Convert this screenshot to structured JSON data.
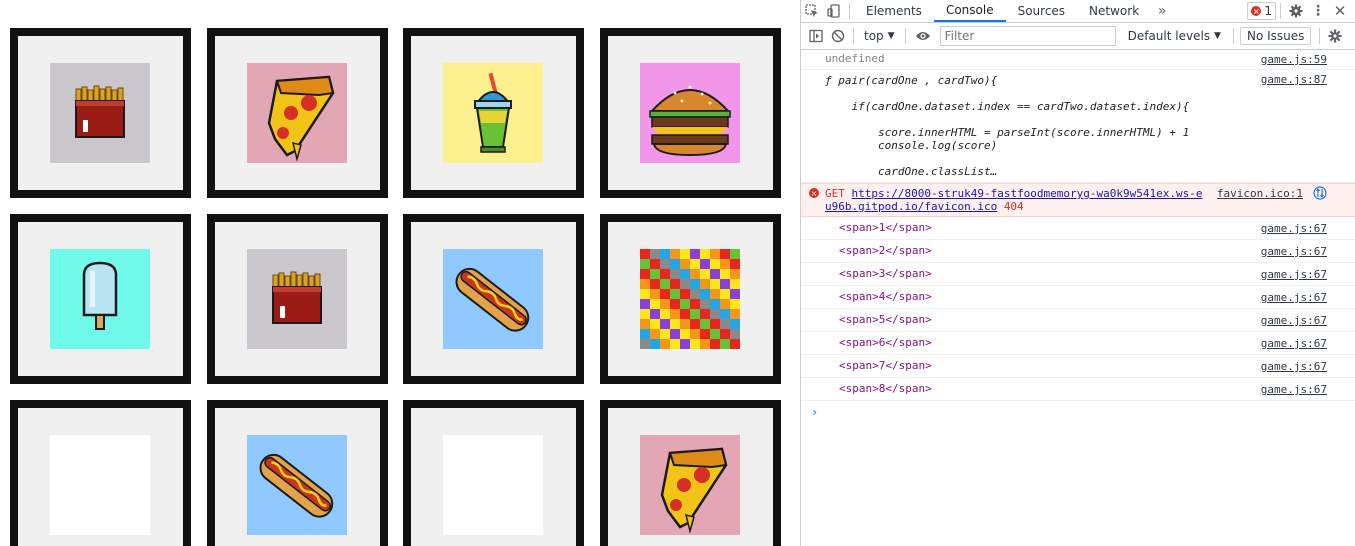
{
  "game": {
    "cards": [
      {
        "food": "fries",
        "bg": "#cac8cc"
      },
      {
        "food": "pizza",
        "bg": "#e3a6b5"
      },
      {
        "food": "slushie",
        "bg": "#fdf08f"
      },
      {
        "food": "burger",
        "bg": "#f196e9"
      },
      {
        "food": "popsicle",
        "bg": "#6ffaea"
      },
      {
        "food": "fries",
        "bg": "#cac8cc"
      },
      {
        "food": "hotdog",
        "bg": "#8fc9ff"
      },
      {
        "food": "checker",
        "bg": "#ffffff"
      },
      {
        "food": "blank",
        "bg": "#ffffff"
      },
      {
        "food": "hotdog",
        "bg": "#8fc9ff"
      },
      {
        "food": "blank",
        "bg": "#ffffff"
      },
      {
        "food": "pizza",
        "bg": "#e3a6b5"
      }
    ]
  },
  "devtools": {
    "tabs": [
      "Elements",
      "Console",
      "Sources",
      "Network"
    ],
    "active_tab": "Console",
    "error_count": "1",
    "context": "top",
    "filter_placeholder": "Filter",
    "levels": "Default levels",
    "issues": "No Issues",
    "messages": {
      "m1": {
        "text": "undefined",
        "src": "game.js:59"
      },
      "m2": {
        "src": "game.js:87",
        "l1": "ƒ pair(cardOne , cardTwo){",
        "l2": "    if(cardOne.dataset.index == cardTwo.dataset.index){",
        "l3": "        score.innerHTML = parseInt(score.innerHTML) + 1",
        "l4": "        console.log(score)",
        "l5": "        cardOne.classList…"
      },
      "err": {
        "method": "GET",
        "url": "https://8000-struk49-fastfoodmemoryg-wa0k9w541ex.ws-eu96b.gitpod.io/favicon.ico",
        "status": "404",
        "src": "favicon.ico:1"
      },
      "spans": [
        {
          "text": "<span>1</span>",
          "src": "game.js:67"
        },
        {
          "text": "<span>2</span>",
          "src": "game.js:67"
        },
        {
          "text": "<span>3</span>",
          "src": "game.js:67"
        },
        {
          "text": "<span>4</span>",
          "src": "game.js:67"
        },
        {
          "text": "<span>5</span>",
          "src": "game.js:67"
        },
        {
          "text": "<span>6</span>",
          "src": "game.js:67"
        },
        {
          "text": "<span>7</span>",
          "src": "game.js:67"
        },
        {
          "text": "<span>8</span>",
          "src": "game.js:67"
        }
      ]
    }
  }
}
